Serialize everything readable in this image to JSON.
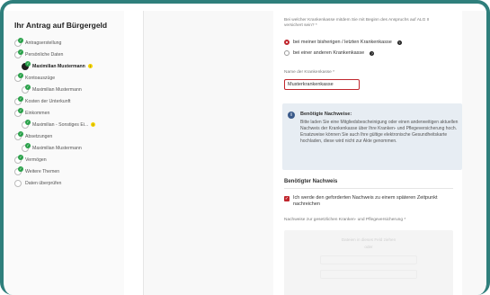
{
  "sidebar": {
    "title": "Ihr Antrag auf Bürgergeld",
    "items": [
      {
        "label": "Antragserstellung",
        "state": "done",
        "indent": 0
      },
      {
        "label": "Persönliche Daten",
        "state": "done",
        "indent": 0
      },
      {
        "label": "Maximilian Mustermann",
        "state": "current",
        "indent": 1,
        "warning": "!"
      },
      {
        "label": "Kontoauszüge",
        "state": "done",
        "indent": 0
      },
      {
        "label": "Maximilian Mustermann",
        "state": "done",
        "indent": 1
      },
      {
        "label": "Kosten der Unterkunft",
        "state": "done",
        "indent": 0
      },
      {
        "label": "Einkommen",
        "state": "done",
        "indent": 0
      },
      {
        "label": "Maximilian - Sonstiges Ei...",
        "state": "done",
        "indent": 1,
        "warning": "!"
      },
      {
        "label": "Absetzungen",
        "state": "done",
        "indent": 0
      },
      {
        "label": "Maximilian Mustermann",
        "state": "done",
        "indent": 1
      },
      {
        "label": "Vermögen",
        "state": "done",
        "indent": 0
      },
      {
        "label": "Weitere Themen",
        "state": "done",
        "indent": 0
      },
      {
        "label": "Daten überprüfen",
        "state": "todo",
        "indent": 0
      }
    ]
  },
  "form": {
    "question_line1": "Bei welcher Krankenkasse mitdem Sie mit Beginn des Anspruchs auf ALG II",
    "question_line2": "versichert sein? *",
    "radio_options": [
      {
        "label": "bei meiner bisherigen / letzten Krankenkasse",
        "selected": true
      },
      {
        "label": "bei einer anderen Krankenkasse",
        "selected": false
      }
    ],
    "name_label": "Name der Krankenkasse *",
    "name_value": "Musterkrankenkasse",
    "info_title": "Benötigte Nachweise:",
    "info_body": "Bitte laden Sie eine Mitgliedsbescheinigung oder einen anderweitigen aktuellen Nachweis der Krankenkasse über Ihre Kranken- und Pflegeversicherung hoch. Ersatzweise können Sie auch Ihre gültige elektronische Gesundheitskarte hochladen, diese wird nicht zur Akte genommen.",
    "section_title": "Benötigter Nachweis",
    "later_checkbox_label": "Ich werde den geforderten Nachweis zu einem späteren Zeitpunkt nachreichen",
    "upload_label": "Nachweise zur gesetzlichen Kranken- und Pflegeversicherung *",
    "upload_ghost_1": "Dateien in dieses Feld ziehen",
    "upload_ghost_2": "oder"
  },
  "colors": {
    "frame": "#2f7f7c",
    "accent": "#c0262d",
    "check": "#2aa14a",
    "warning": "#f5d400",
    "info_bg": "#e7edf3"
  }
}
